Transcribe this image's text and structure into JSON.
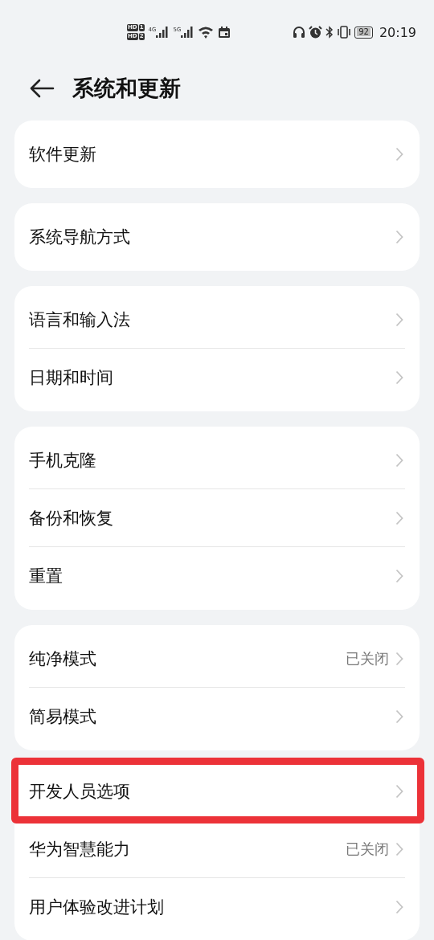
{
  "status_bar": {
    "sims": [
      {
        "badge": "HD",
        "slot": "1"
      },
      {
        "badge": "HD",
        "slot": "2"
      }
    ],
    "networks": [
      "4G",
      "5G"
    ],
    "battery": "92",
    "time": "20:19"
  },
  "header": {
    "title": "系统和更新"
  },
  "groups": [
    {
      "items": [
        {
          "label": "软件更新",
          "highlighted": false
        }
      ]
    },
    {
      "items": [
        {
          "label": "系统导航方式",
          "highlighted": false
        }
      ]
    },
    {
      "items": [
        {
          "label": "语言和输入法",
          "highlighted": false
        },
        {
          "label": "日期和时间",
          "highlighted": false
        }
      ]
    },
    {
      "items": [
        {
          "label": "手机克隆",
          "highlighted": false
        },
        {
          "label": "备份和恢复",
          "highlighted": false
        },
        {
          "label": "重置",
          "highlighted": false
        }
      ]
    },
    {
      "items": [
        {
          "label": "纯净模式",
          "value": "已关闭",
          "highlighted": false
        },
        {
          "label": "简易模式",
          "highlighted": false
        }
      ]
    },
    {
      "items": [
        {
          "label": "开发人员选项",
          "highlighted": true
        },
        {
          "label": "华为智慧能力",
          "value": "已关闭",
          "highlighted": false
        },
        {
          "label": "用户体验改进计划",
          "highlighted": false
        }
      ]
    }
  ]
}
